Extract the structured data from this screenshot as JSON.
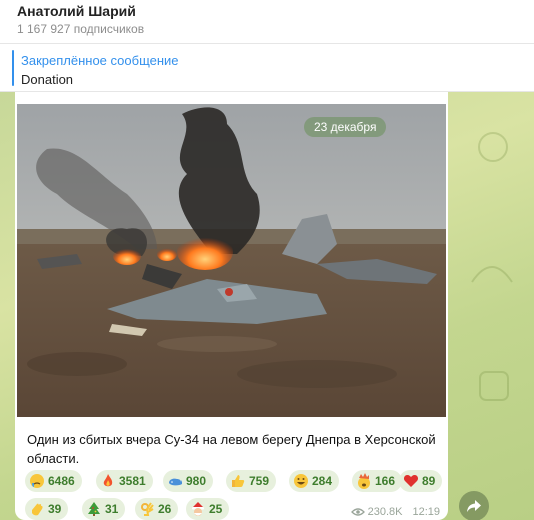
{
  "header": {
    "channel_name": "Анатолий Шарий",
    "subscribers": "1 167 927 подписчиков"
  },
  "pinned": {
    "title": "Закреплённое сообщение",
    "text": "Donation"
  },
  "message": {
    "date_chip": "23 декабря",
    "caption": "Один из сбитых вчера Су-34 на левом берегу Днепра в Херсонской области.",
    "views": "230.8K",
    "time": "12:19"
  },
  "reactions": [
    {
      "icon": "crying-face-icon",
      "count": "6486"
    },
    {
      "icon": "fire-icon",
      "count": "3581"
    },
    {
      "icon": "whale-icon",
      "count": "980"
    },
    {
      "icon": "thumbs-up-icon",
      "count": "759"
    },
    {
      "icon": "grinning-face-icon",
      "count": "284"
    },
    {
      "icon": "exploding-head-icon",
      "count": "166"
    },
    {
      "icon": "red-heart-icon",
      "count": "89"
    },
    {
      "icon": "clapping-hands-icon",
      "count": "39"
    },
    {
      "icon": "christmas-tree-icon",
      "count": "31"
    },
    {
      "icon": "ok-hand-icon",
      "count": "26"
    },
    {
      "icon": "santa-face-icon",
      "count": "25"
    }
  ],
  "colors": {
    "accent": "#3390ec",
    "reaction_bg": "#e7f0dd",
    "reaction_text": "#3e7d2d",
    "chat_background": "#c7d899"
  }
}
